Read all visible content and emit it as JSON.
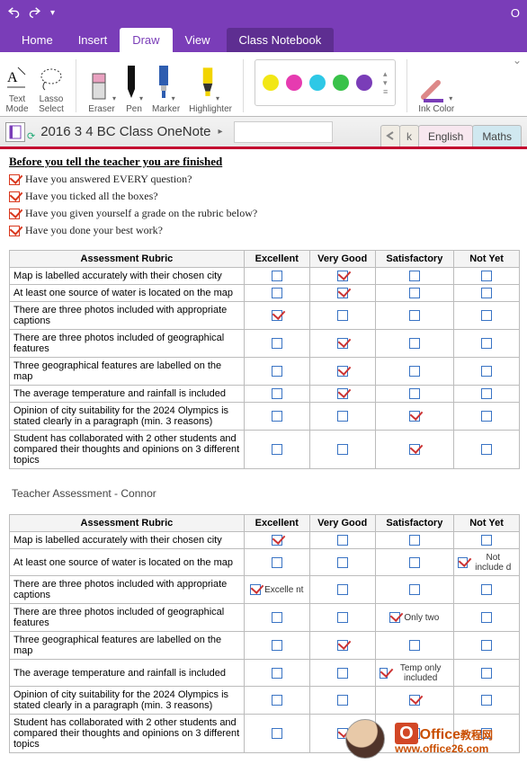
{
  "window": {
    "title_fragment": "O"
  },
  "menu": {
    "home": "Home",
    "insert": "Insert",
    "draw": "Draw",
    "view": "View",
    "classnb": "Class Notebook"
  },
  "ribbon": {
    "text_mode": "Text\nMode",
    "lasso": "Lasso\nSelect",
    "eraser": "Eraser",
    "pen": "Pen",
    "marker": "Marker",
    "highlighter": "Highlighter",
    "ink_color": "Ink Color",
    "swatch_colors": [
      "#f2e716",
      "#e63bb0",
      "#2ec8e6",
      "#39c24a",
      "#7a3db8"
    ]
  },
  "notebook": {
    "title": "2016 3 4 BC Class OneNote",
    "section_tabs": {
      "stub": "k",
      "english": "English",
      "maths": "Maths"
    }
  },
  "checklist": {
    "heading": "Before you tell the teacher you are finished",
    "items": [
      "Have you answered EVERY question?",
      "Have you ticked all the boxes?",
      "Have you given yourself a grade on the rubric below?",
      "Have you done your best work?"
    ]
  },
  "rubric_headers": {
    "rubric": "Assessment Rubric",
    "c1": "Excellent",
    "c2": "Very Good",
    "c3": "Satisfactory",
    "c4": "Not Yet"
  },
  "criteria": [
    "Map is labelled accurately with their chosen city",
    "At least one source of water is located on the map",
    "There are three photos included with appropriate captions",
    "There are three photos included of geographical features",
    "Three geographical features are labelled on the map",
    "The average temperature and rainfall is included",
    "Opinion of city suitability for the 2024 Olympics is stated clearly in a paragraph (min. 3 reasons)",
    "Student has collaborated with 2 other students and compared their thoughts and opinions on 3 different topics"
  ],
  "student_marks": [
    [
      false,
      true,
      false,
      false
    ],
    [
      false,
      true,
      false,
      false
    ],
    [
      true,
      false,
      false,
      false
    ],
    [
      false,
      true,
      false,
      false
    ],
    [
      false,
      true,
      false,
      false
    ],
    [
      false,
      true,
      false,
      false
    ],
    [
      false,
      false,
      true,
      false
    ],
    [
      false,
      false,
      true,
      false
    ]
  ],
  "teacher": {
    "title": "Teacher Assessment - Connor",
    "rows": [
      {
        "c": [
          true,
          false,
          false,
          false
        ],
        "n": [
          "",
          "",
          "",
          ""
        ]
      },
      {
        "c": [
          false,
          false,
          false,
          true
        ],
        "n": [
          "",
          "",
          "",
          "Not include d"
        ]
      },
      {
        "c": [
          true,
          false,
          false,
          false
        ],
        "n": [
          "Excelle nt",
          "",
          "",
          ""
        ]
      },
      {
        "c": [
          false,
          false,
          true,
          false
        ],
        "n": [
          "",
          "",
          "Only two",
          ""
        ]
      },
      {
        "c": [
          false,
          true,
          false,
          false
        ],
        "n": [
          "",
          "",
          "",
          ""
        ]
      },
      {
        "c": [
          false,
          false,
          true,
          false
        ],
        "n": [
          "",
          "",
          "Temp only included",
          ""
        ]
      },
      {
        "c": [
          false,
          false,
          true,
          false
        ],
        "n": [
          "",
          "",
          "",
          ""
        ]
      },
      {
        "c": [
          false,
          true,
          false,
          false
        ],
        "n": [
          "",
          "",
          "",
          ""
        ]
      }
    ]
  },
  "watermark": {
    "brand": "Office",
    "tag": "教程网",
    "url": "www.office26.com"
  }
}
